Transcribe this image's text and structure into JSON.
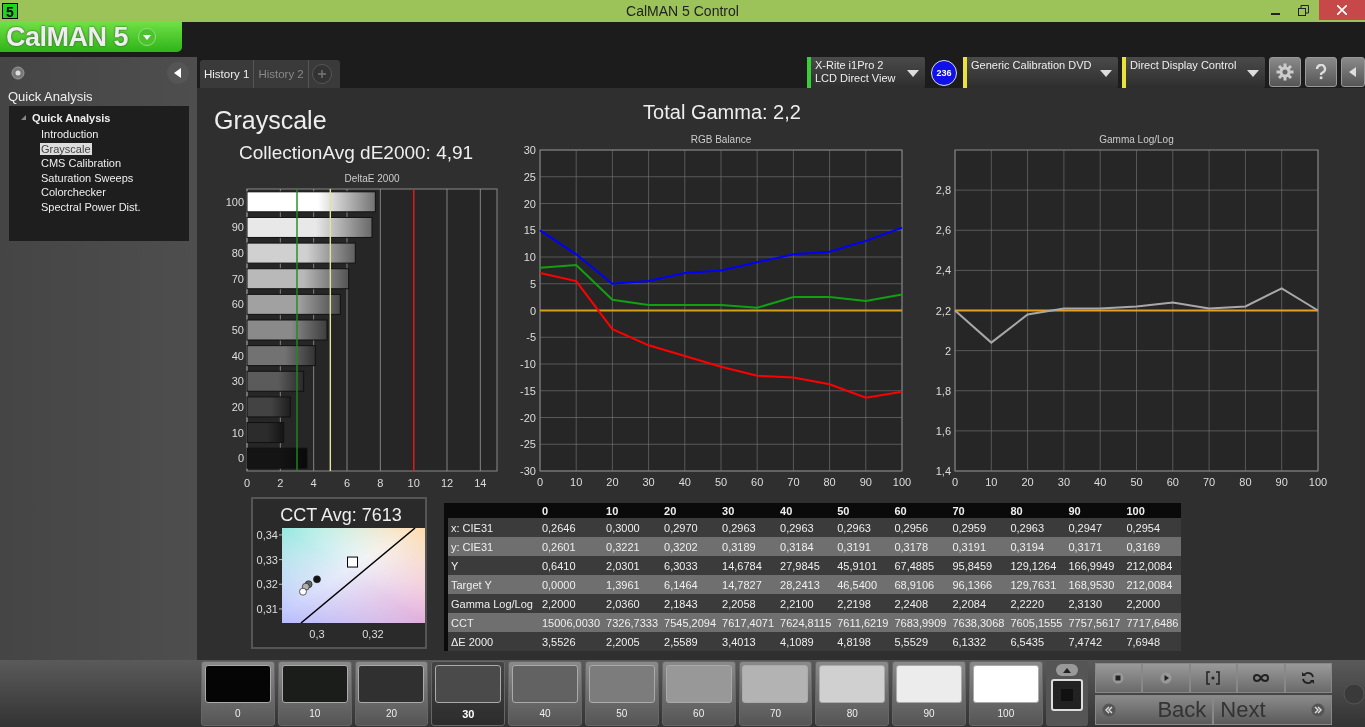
{
  "window": {
    "title": "CalMAN 5 Control",
    "app_icon": "5"
  },
  "logo": {
    "text": "CalMAN 5"
  },
  "sidebar": {
    "heading": "Quick Analysis",
    "tree": [
      {
        "label": "Quick Analysis",
        "expanded": true,
        "children": [
          {
            "label": "Introduction",
            "selected": false
          },
          {
            "label": "Grayscale",
            "selected": true
          },
          {
            "label": "CMS Calibration",
            "selected": false
          },
          {
            "label": "Saturation Sweeps",
            "selected": false
          },
          {
            "label": "Colorchecker",
            "selected": false
          },
          {
            "label": "Spectral Power Dist.",
            "selected": false
          }
        ]
      }
    ]
  },
  "tabs": [
    {
      "label": "History 1",
      "selected": true
    },
    {
      "label": "History 2",
      "selected": false
    }
  ],
  "sources": [
    {
      "lines": [
        "X-Rite i1Pro 2",
        "LCD Direct View"
      ],
      "color": "#35d035",
      "badge": "236"
    },
    {
      "lines": [
        "Generic Calibration DVD"
      ],
      "color": "#e8e23a"
    },
    {
      "lines": [
        "Direct Display Control"
      ],
      "color": "#e8e23a"
    }
  ],
  "page": {
    "title": "Grayscale",
    "average": "CollectionAvg dE2000: 4,91",
    "gamma_total": "Total Gamma: 2,2",
    "deltae_chart": {
      "chart_data": {
        "type": "bar",
        "orientation": "horizontal",
        "title": "DeltaE 2000",
        "categories": [
          "100",
          "90",
          "80",
          "70",
          "60",
          "50",
          "40",
          "30",
          "20",
          "10",
          "0"
        ],
        "values": [
          7.7,
          7.5,
          6.5,
          6.1,
          5.6,
          4.8,
          4.1,
          3.4,
          2.6,
          2.2,
          3.6
        ],
        "xlim": [
          0,
          15
        ],
        "xticks": [
          0,
          2,
          4,
          6,
          8,
          10,
          12,
          14
        ],
        "grid": true,
        "ref_lines": [
          {
            "axis": "x",
            "value": 3,
            "color": "#1f8a1f"
          },
          {
            "axis": "x",
            "value": 5,
            "color": "#e8e0a0"
          },
          {
            "axis": "x",
            "value": 10,
            "color": "#e01818"
          }
        ]
      }
    },
    "rgb_chart": {
      "chart_data": {
        "type": "line",
        "title": "RGB Balance",
        "x": [
          0,
          10,
          20,
          30,
          40,
          50,
          60,
          70,
          80,
          90,
          100
        ],
        "series": [
          {
            "color": "#ff0000",
            "values": [
              7,
              5.5,
              -3.5,
              -6.5,
              -8.5,
              -10.5,
              -12.2,
              -12.5,
              -13.8,
              -16.3,
              -15.2
            ]
          },
          {
            "color": "#10a010",
            "values": [
              8,
              8.5,
              2,
              1,
              1,
              1,
              0.5,
              2.5,
              2.5,
              1.8,
              3
            ]
          },
          {
            "color": "#0000ff",
            "values": [
              15,
              10.5,
              5,
              5.5,
              7,
              7.5,
              9,
              10.5,
              11,
              13,
              15.5
            ]
          }
        ],
        "xlim": [
          0,
          100
        ],
        "ylim": [
          -30,
          30
        ],
        "xticks": [
          0,
          10,
          20,
          30,
          40,
          50,
          60,
          70,
          80,
          90,
          100
        ],
        "yticks": [
          -30,
          -25,
          -20,
          -15,
          -10,
          -5,
          0,
          5,
          10,
          15,
          20,
          25,
          30
        ],
        "grid": true,
        "ref_lines": [
          {
            "axis": "y",
            "value": 0,
            "color": "#d4a017"
          }
        ]
      }
    },
    "gamma_chart": {
      "chart_data": {
        "type": "line",
        "title": "Gamma Log/Log",
        "x": [
          0,
          10,
          20,
          30,
          40,
          50,
          60,
          70,
          80,
          90,
          100
        ],
        "series": [
          {
            "color": "#a8a8a8",
            "values": [
              2.2,
              2.04,
              2.18,
              2.21,
              2.21,
              2.22,
              2.24,
              2.21,
              2.22,
              2.31,
              2.2
            ]
          }
        ],
        "xlim": [
          0,
          100
        ],
        "ylim": [
          1.4,
          3.0
        ],
        "xticks": [
          0,
          10,
          20,
          30,
          40,
          50,
          60,
          70,
          80,
          90,
          100
        ],
        "yticks": [
          {
            "value": 1.4,
            "label": "1,4"
          },
          {
            "value": 1.6,
            "label": "1,6"
          },
          {
            "value": 1.8,
            "label": "1,8"
          },
          {
            "value": 2,
            "label": "2"
          },
          {
            "value": 2.2,
            "label": "2,2"
          },
          {
            "value": 2.4,
            "label": "2,4"
          },
          {
            "value": 2.6,
            "label": "2,6"
          },
          {
            "value": 2.8,
            "label": "2,8"
          }
        ],
        "grid": true,
        "ref_lines": [
          {
            "axis": "y",
            "value": 2.2,
            "color": "#e8a020"
          }
        ]
      }
    },
    "cct": {
      "chart_data": {
        "type": "scatter",
        "title": "CCT Avg: 7613",
        "x": [
          0.3,
          0.297,
          0.296,
          0.295
        ],
        "series": [
          {
            "color": "#202020",
            "values": [
              0.322,
              0.32,
              0.319,
              0.317
            ]
          }
        ],
        "xlim": [
          0.2875,
          0.3386
        ],
        "ylim": [
          0.3043,
          0.3428
        ],
        "xticks": [
          {
            "value": 0.3,
            "label": "0,3"
          },
          {
            "value": 0.32,
            "label": "0,32"
          }
        ],
        "yticks": [
          {
            "value": 0.31,
            "label": "0,31"
          },
          {
            "value": 0.32,
            "label": "0,32"
          },
          {
            "value": 0.33,
            "label": "0,33"
          },
          {
            "value": 0.34,
            "label": "0,34"
          }
        ]
      }
    },
    "table": {
      "columns": [
        "0",
        "10",
        "20",
        "30",
        "40",
        "50",
        "60",
        "70",
        "80",
        "90",
        "100"
      ],
      "rows": [
        {
          "label": "x: CIE31",
          "cells": [
            "0,2646",
            "0,3000",
            "0,2970",
            "0,2963",
            "0,2963",
            "0,2963",
            "0,2956",
            "0,2959",
            "0,2963",
            "0,2947",
            "0,2954"
          ]
        },
        {
          "label": "y: CIE31",
          "cells": [
            "0,2601",
            "0,3221",
            "0,3202",
            "0,3189",
            "0,3184",
            "0,3191",
            "0,3178",
            "0,3191",
            "0,3194",
            "0,3171",
            "0,3169"
          ]
        },
        {
          "label": "Y",
          "cells": [
            "0,6410",
            "2,0301",
            "6,3033",
            "14,6784",
            "27,9845",
            "45,9101",
            "67,4885",
            "95,8459",
            "129,1264",
            "166,9949",
            "212,0084"
          ]
        },
        {
          "label": "Target Y",
          "cells": [
            "0,0000",
            "1,3961",
            "6,1464",
            "14,7827",
            "28,2413",
            "46,5400",
            "68,9106",
            "96,1366",
            "129,7631",
            "168,9530",
            "212,0084"
          ]
        },
        {
          "label": "Gamma Log/Log",
          "cells": [
            "2,2000",
            "2,0360",
            "2,1843",
            "2,2058",
            "2,2100",
            "2,2198",
            "2,2408",
            "2,2084",
            "2,2220",
            "2,3130",
            "2,2000"
          ]
        },
        {
          "label": "CCT",
          "cells": [
            "15006,0030",
            "7326,7333",
            "7545,2094",
            "7617,4071",
            "7624,8115",
            "7611,6219",
            "7683,9909",
            "7638,3068",
            "7605,1555",
            "7757,5617",
            "7717,6486"
          ]
        },
        {
          "label": "ΔE 2000",
          "cells": [
            "3,5526",
            "2,2005",
            "2,5589",
            "3,4013",
            "4,1089",
            "4,8198",
            "5,5529",
            "6,1332",
            "6,5435",
            "7,4742",
            "7,6948"
          ]
        }
      ]
    }
  },
  "swatches": [
    {
      "label": "0",
      "color": "#050505",
      "selected": false
    },
    {
      "label": "10",
      "color": "#1b1d1a",
      "selected": false
    },
    {
      "label": "20",
      "color": "#303030",
      "selected": false
    },
    {
      "label": "30",
      "color": "#4a4a4a",
      "selected": true
    },
    {
      "label": "40",
      "color": "#626262",
      "selected": false
    },
    {
      "label": "50",
      "color": "#7c7c7c",
      "selected": false
    },
    {
      "label": "60",
      "color": "#989898",
      "selected": false
    },
    {
      "label": "70",
      "color": "#b3b3b3",
      "selected": false
    },
    {
      "label": "80",
      "color": "#d0d0d0",
      "selected": false
    },
    {
      "label": "90",
      "color": "#ececec",
      "selected": false
    },
    {
      "label": "100",
      "color": "#ffffff",
      "selected": false
    }
  ],
  "nav": {
    "back": "Back",
    "next": "Next"
  }
}
